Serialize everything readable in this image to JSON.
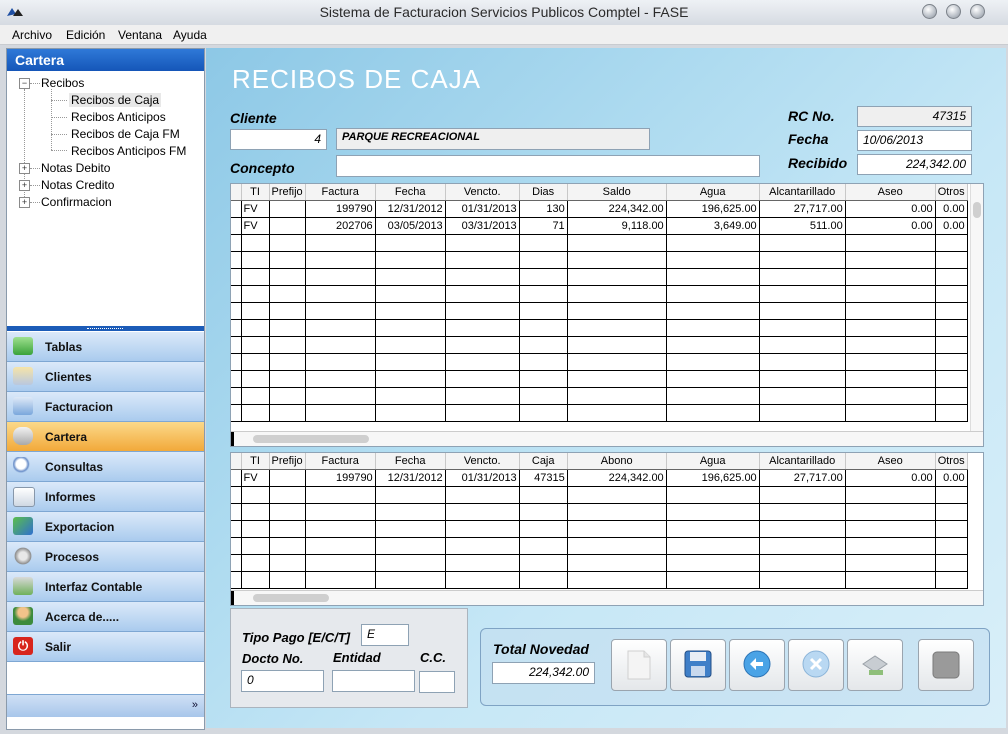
{
  "window": {
    "title": "Sistema de Facturacion Servicios Publicos Comptel - FASE"
  },
  "menu": [
    "Archivo",
    "Edición",
    "Ventana",
    "Ayuda"
  ],
  "sidebar": {
    "header": "Cartera",
    "tree": {
      "recibos": "Recibos",
      "recibos_children": [
        "Recibos de Caja",
        "Recibos Anticipos",
        "Recibos de Caja FM",
        "Recibos Anticipos FM"
      ],
      "notas_debito": "Notas Debito",
      "notas_credito": "Notas Credito",
      "confirmacion": "Confirmacion"
    },
    "nav": [
      "Tablas",
      "Clientes",
      "Facturacion",
      "Cartera",
      "Consultas",
      "Informes",
      "Exportacion",
      "Procesos",
      "Interfaz Contable",
      "Acerca de.....",
      "Salir"
    ],
    "active_nav": "Cartera",
    "expand_icon": "»"
  },
  "form": {
    "title": "RECIBOS DE CAJA",
    "cliente_label": "Cliente",
    "cliente_code": "4",
    "cliente_name": "PARQUE  RECREACIONAL",
    "concepto_label": "Concepto",
    "concepto_value": "",
    "rc_label": "RC No.",
    "rc_value": "47315",
    "fecha_label": "Fecha",
    "fecha_value": "10/06/2013",
    "recibido_label": "Recibido",
    "recibido_value": "224,342.00"
  },
  "grid1": {
    "columns": [
      "TI",
      "Prefijo",
      "Factura",
      "Fecha",
      "Vencto.",
      "Dias",
      "Saldo",
      "Agua",
      "Alcantarillado",
      "Aseo",
      "Otros"
    ],
    "rows": [
      [
        "FV",
        "",
        "199790",
        "12/31/2012",
        "01/31/2013",
        "130",
        "224,342.00",
        "196,625.00",
        "27,717.00",
        "0.00",
        "0.00"
      ],
      [
        "FV",
        "",
        "202706",
        "03/05/2013",
        "03/31/2013",
        "71",
        "9,118.00",
        "3,649.00",
        "511.00",
        "0.00",
        "0.00"
      ]
    ]
  },
  "grid2": {
    "columns": [
      "TI",
      "Prefijo",
      "Factura",
      "Fecha",
      "Vencto.",
      "Caja",
      "Abono",
      "Agua",
      "Alcantarillado",
      "Aseo",
      "Otros"
    ],
    "rows": [
      [
        "FV",
        "",
        "199790",
        "12/31/2012",
        "01/31/2013",
        "47315",
        "224,342.00",
        "196,625.00",
        "27,717.00",
        "0.00",
        "0.00"
      ]
    ]
  },
  "pago": {
    "tipo_label": "Tipo Pago [E/C/T]",
    "tipo_value": "E",
    "docto_label": "Docto No.",
    "docto_value": "0",
    "entidad_label": "Entidad",
    "entidad_value": "",
    "cc_label": "C.C.",
    "cc_value": ""
  },
  "total": {
    "label": "Total Novedad",
    "value": "224,342.00"
  },
  "toolbar_icons": [
    "new-document-icon",
    "save-icon",
    "undo-icon",
    "cancel-icon",
    "print-icon",
    "stop-icon"
  ],
  "colors": {
    "sidebar_header": "#1556b8",
    "active_nav": "#f2a93a",
    "panel_bg": "#aedbf0"
  }
}
